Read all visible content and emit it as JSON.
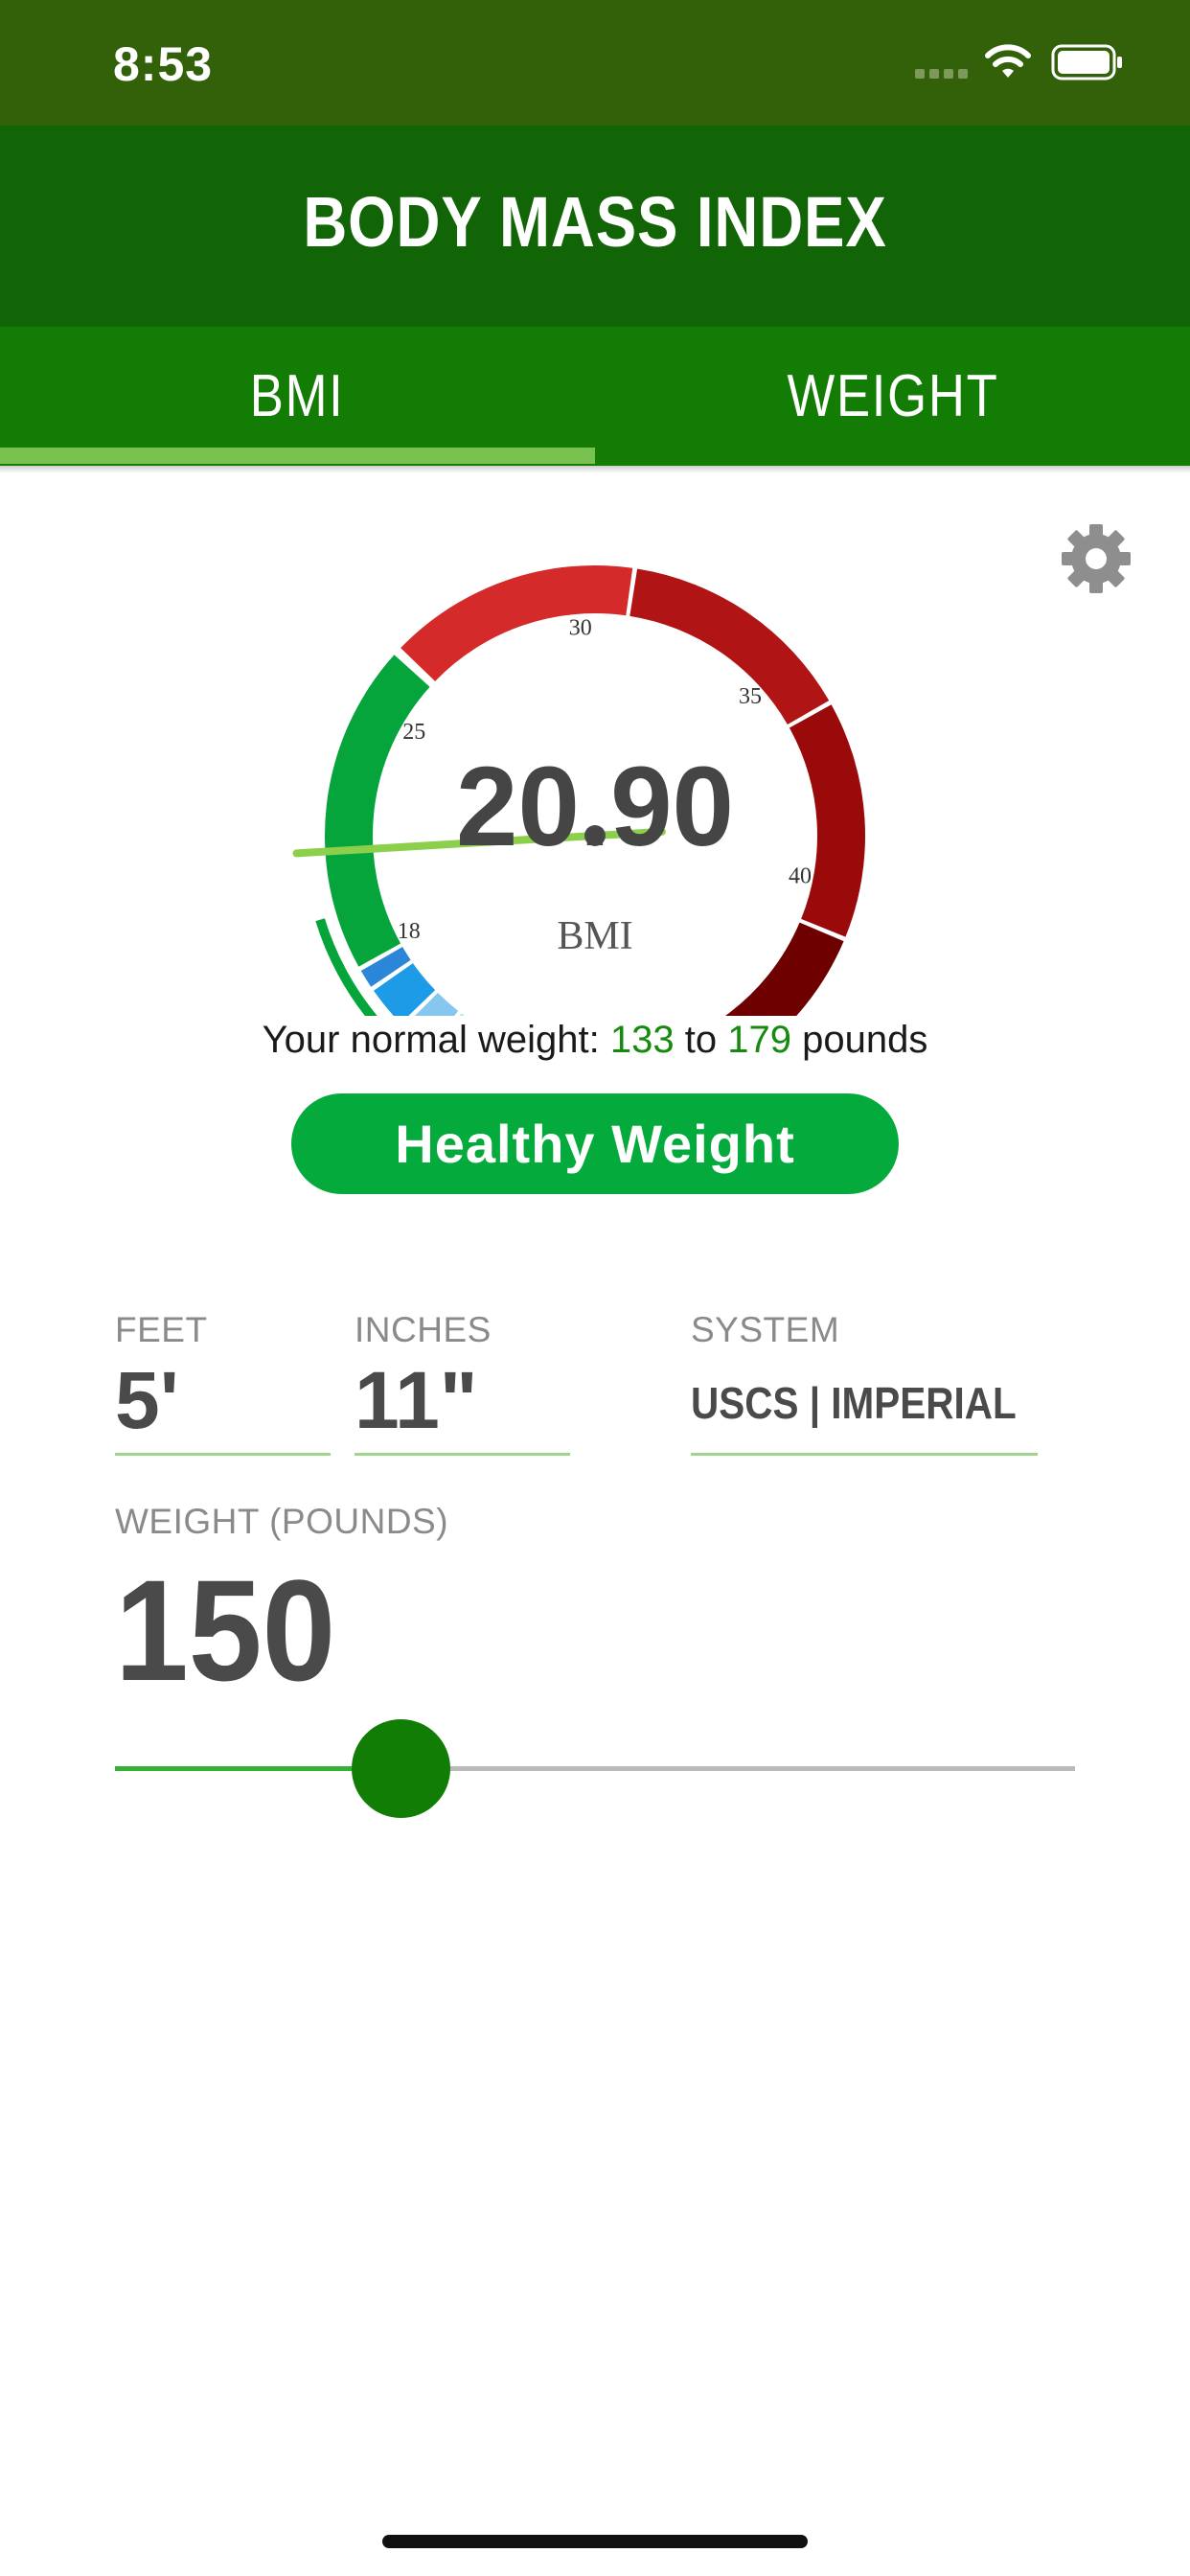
{
  "status_bar": {
    "time": "8:53"
  },
  "header": {
    "title": "BODY MASS INDEX"
  },
  "tabs": [
    {
      "label": "BMI",
      "selected": true
    },
    {
      "label": "WEIGHT",
      "selected": false
    }
  ],
  "gauge": {
    "value": "20.90",
    "value_number": 20.9,
    "unit_label": "BMI",
    "ticks": [
      "18",
      "25",
      "30",
      "35",
      "40"
    ],
    "colors": {
      "underweight": "#1e9be6",
      "healthy": "#06a53c",
      "overweight": "#d42a2a",
      "obese": "#b01414",
      "severe": "#6e0000",
      "needle": "#8bcf4a"
    }
  },
  "summary": {
    "prefix": "Your normal weight:",
    "low": "133",
    "mid": "to",
    "high": "179",
    "suffix": "pounds"
  },
  "status": {
    "label": "Healthy Weight",
    "color": "#05aa3c"
  },
  "inputs": {
    "feet": {
      "label": "FEET",
      "value": "5'"
    },
    "inches": {
      "label": "INCHES",
      "value": "11\""
    },
    "system": {
      "label": "SYSTEM",
      "value": "USCS | IMPERIAL"
    },
    "weight": {
      "label": "WEIGHT (POUNDS)",
      "value": "150"
    }
  },
  "slider": {
    "position_fraction": 0.3
  },
  "icons": {
    "settings": "gear-icon",
    "wifi": "wifi-icon",
    "battery": "battery-icon"
  }
}
